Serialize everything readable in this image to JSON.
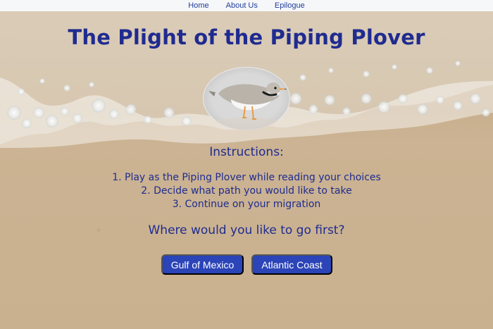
{
  "nav": {
    "home": "Home",
    "about": "About Us",
    "epilogue": "Epilogue"
  },
  "title": "The Plight of the Piping Plover",
  "instructions": {
    "title": "Instructions:",
    "steps": [
      "1. Play as the Piping Plover while reading your choices",
      "2. Decide what path you would like to take",
      "3. Continue on your migration"
    ]
  },
  "question": "Where would you like to go first?",
  "buttons": {
    "gulf": "Gulf of Mexico",
    "atlantic": "Atlantic Coast"
  },
  "icons": {
    "bird": "piping-plover-icon"
  },
  "colors": {
    "primary_text": "#1f2b8f",
    "button_bg": "#2b44b8",
    "nav_bg": "#f6f7f9"
  }
}
